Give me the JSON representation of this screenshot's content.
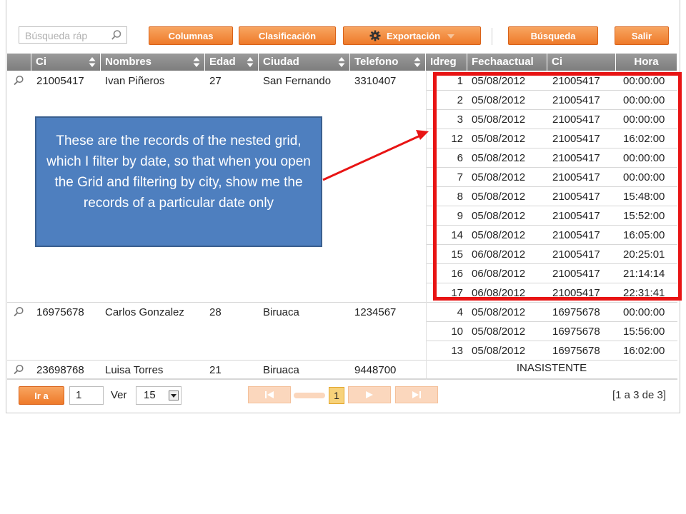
{
  "toolbar": {
    "search_placeholder": "Búsqueda ráp",
    "columns_label": "Columnas",
    "sort_label": "Clasificación",
    "export_label": "Exportación",
    "search_label": "Búsqueda",
    "exit_label": "Salir"
  },
  "columns": [
    "Ci",
    "Nombres",
    "Edad",
    "Ciudad",
    "Telefono",
    "Idreg",
    "Fechaactual",
    "Ci",
    "Hora"
  ],
  "rows": [
    {
      "ci": "21005417",
      "nombres": "Ivan Piñeros",
      "edad": "27",
      "ciudad": "San Fernando",
      "telefono": "3310407",
      "sub": [
        {
          "idreg": "1",
          "fecha": "05/08/2012",
          "ci": "21005417",
          "hora": "00:00:00"
        },
        {
          "idreg": "2",
          "fecha": "05/08/2012",
          "ci": "21005417",
          "hora": "00:00:00"
        },
        {
          "idreg": "3",
          "fecha": "05/08/2012",
          "ci": "21005417",
          "hora": "00:00:00"
        },
        {
          "idreg": "12",
          "fecha": "05/08/2012",
          "ci": "21005417",
          "hora": "16:02:00"
        },
        {
          "idreg": "6",
          "fecha": "05/08/2012",
          "ci": "21005417",
          "hora": "00:00:00"
        },
        {
          "idreg": "7",
          "fecha": "05/08/2012",
          "ci": "21005417",
          "hora": "00:00:00"
        },
        {
          "idreg": "8",
          "fecha": "05/08/2012",
          "ci": "21005417",
          "hora": "15:48:00"
        },
        {
          "idreg": "9",
          "fecha": "05/08/2012",
          "ci": "21005417",
          "hora": "15:52:00"
        },
        {
          "idreg": "14",
          "fecha": "05/08/2012",
          "ci": "21005417",
          "hora": "16:05:00"
        },
        {
          "idreg": "15",
          "fecha": "06/08/2012",
          "ci": "21005417",
          "hora": "20:25:01"
        },
        {
          "idreg": "16",
          "fecha": "06/08/2012",
          "ci": "21005417",
          "hora": "21:14:14"
        },
        {
          "idreg": "17",
          "fecha": "06/08/2012",
          "ci": "21005417",
          "hora": "22:31:41"
        }
      ]
    },
    {
      "ci": "16975678",
      "nombres": "Carlos Gonzalez",
      "edad": "28",
      "ciudad": "Biruaca",
      "telefono": "1234567",
      "sub": [
        {
          "idreg": "4",
          "fecha": "05/08/2012",
          "ci": "16975678",
          "hora": "00:00:00"
        },
        {
          "idreg": "10",
          "fecha": "05/08/2012",
          "ci": "16975678",
          "hora": "15:56:00"
        },
        {
          "idreg": "13",
          "fecha": "05/08/2012",
          "ci": "16975678",
          "hora": "16:02:00"
        }
      ]
    },
    {
      "ci": "23698768",
      "nombres": "Luisa Torres",
      "edad": "21",
      "ciudad": "Biruaca",
      "telefono": "9448700",
      "sub_text": "INASISTENTE"
    }
  ],
  "callout": {
    "text": "These are the records of the nested grid, which I filter by date, so that when you open the Grid and filtering by city, show me the records of a particular date only"
  },
  "pager": {
    "go_label": "Ir a",
    "page_value": "1",
    "view_label": "Ver",
    "page_size": "15",
    "current_page": "1",
    "range_text": "[1 a 3 de 3]"
  },
  "colors": {
    "accent_orange": "#ee7a2a",
    "header_gray": "#8a8a8a",
    "highlight_red": "#e81414",
    "callout_blue": "#4e7fbf"
  }
}
